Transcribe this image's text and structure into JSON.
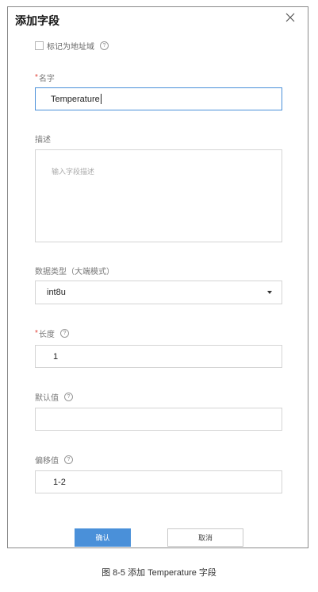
{
  "dialog": {
    "title": "添加字段",
    "checkbox_label": "标记为地址域",
    "help_glyph": "?",
    "name_label": "名字",
    "required_mark": "*",
    "name_value": "Temperature",
    "desc_label": "描述",
    "desc_placeholder": "输入字段描述",
    "type_label": "数据类型（大端模式）",
    "type_value": "int8u",
    "length_label": "长度",
    "length_value": "1",
    "default_label": "默认值",
    "default_value": "",
    "offset_label": "偏移值",
    "offset_value": "1-2",
    "ok_label": "确认",
    "cancel_label": "取消"
  },
  "caption": "图 8-5 添加 Temperature 字段",
  "colors": {
    "accent": "#4a90d9",
    "required": "#e0443b"
  }
}
